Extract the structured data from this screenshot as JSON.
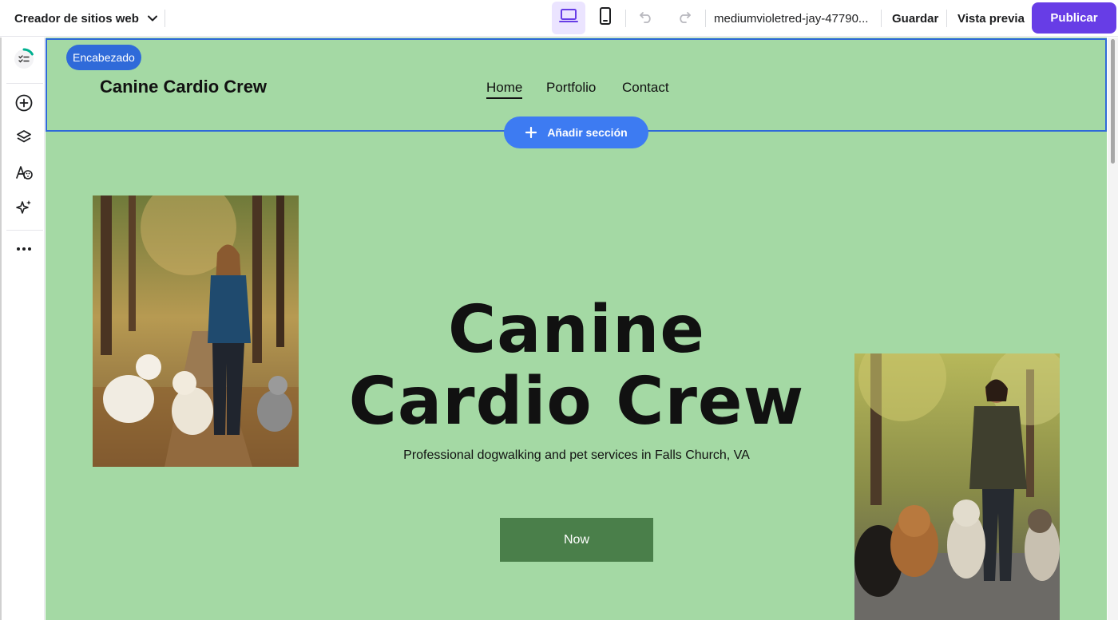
{
  "topbar": {
    "brand_label": "Creador de sitios web",
    "domain": "mediumvioletred-jay-47790...",
    "save_label": "Guardar",
    "preview_label": "Vista previa",
    "publish_label": "Publicar",
    "publish_color": "#673de6",
    "active_device": "desktop"
  },
  "rail": {
    "items": [
      "checklist-icon",
      "add-icon",
      "layers-icon",
      "styles-icon",
      "ai-sparkle-icon",
      "more-icon"
    ]
  },
  "canvas": {
    "background": "#a4d9a4",
    "selection_label": "Encabezado",
    "add_section_label": "Añadir sección",
    "site_logo": "Canine Cardio Crew",
    "nav": [
      "Home",
      "Portfolio",
      "Contact"
    ],
    "active_nav": "Home",
    "hero": {
      "title_line1": "Canine",
      "title_line2": "Cardio Crew",
      "subtitle": "Professional dogwalking and pet services in Falls Church, VA",
      "cta_label": "Now"
    }
  }
}
